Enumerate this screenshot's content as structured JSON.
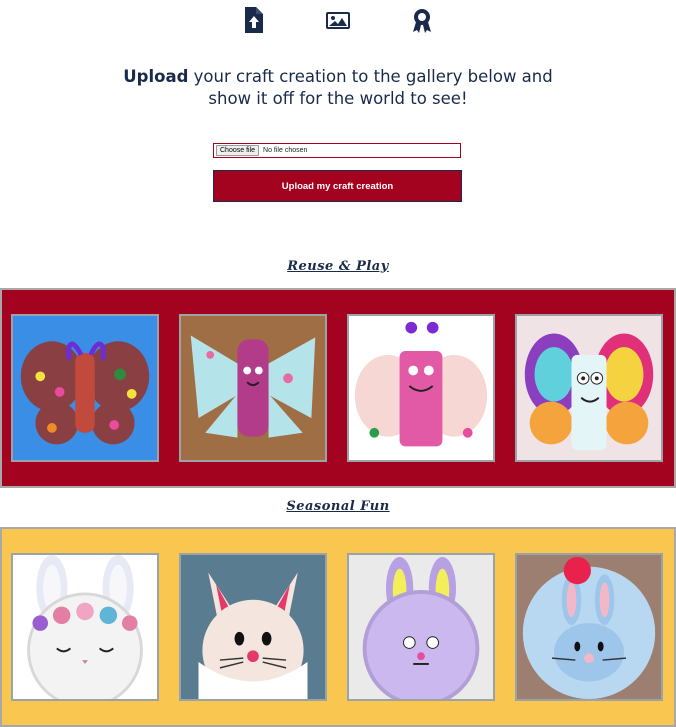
{
  "top_icons": [
    "file-upload-icon",
    "image-icon",
    "award-icon"
  ],
  "intro": {
    "bold": "Upload",
    "line1_rest": " your craft creation to the gallery below and",
    "line2": "show it off for the world to see!"
  },
  "upload_form": {
    "choose_label": "Choose file",
    "file_status": "No file chosen",
    "submit_label": "Upload my craft creation"
  },
  "sections": [
    {
      "title": "Reuse & Play",
      "background": "#a4031f",
      "items": [
        "butterfly-craft-purple-pompoms",
        "butterfly-craft-light-blue-wings",
        "butterfly-craft-pink-roll",
        "butterfly-craft-rainbow-wings"
      ]
    },
    {
      "title": "Seasonal Fun",
      "background": "#f9c74f",
      "items": [
        "bunny-plate-flower-crown",
        "bunny-plate-white-face",
        "bunny-plate-purple",
        "bunny-plate-blue-pompom"
      ]
    }
  ],
  "colors": {
    "navy": "#1a2a4a",
    "crimson": "#a4031f",
    "yellow": "#f9c74f"
  }
}
